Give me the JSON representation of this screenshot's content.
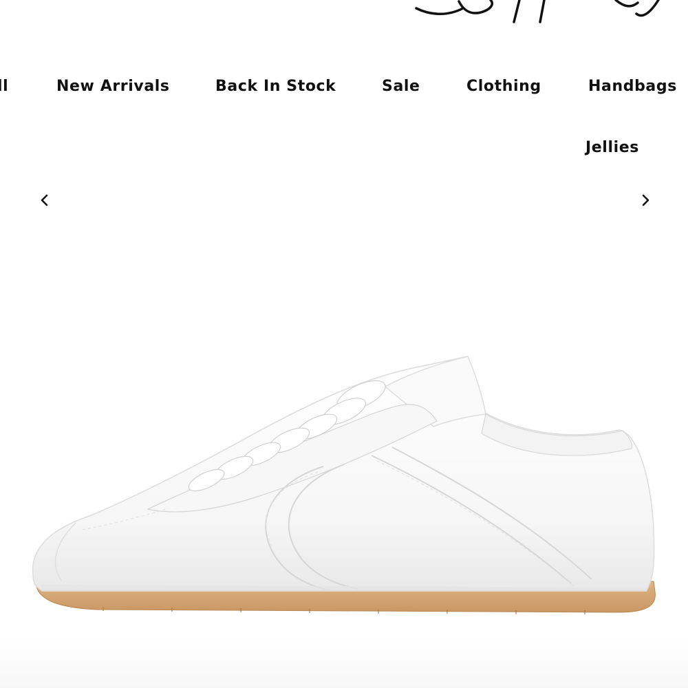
{
  "brand": {
    "logo_name": "brand-logo-signature"
  },
  "nav": {
    "items": [
      {
        "label": "ll"
      },
      {
        "label": "New Arrivals"
      },
      {
        "label": "Back In Stock"
      },
      {
        "label": "Sale"
      },
      {
        "label": "Clothing"
      },
      {
        "label": "Handbags"
      }
    ],
    "sub_item": {
      "label": "Jellies"
    }
  },
  "carousel": {
    "prev_icon": "chevron-left-icon",
    "next_icon": "chevron-right-icon"
  },
  "product": {
    "image": "white-leather-sneaker",
    "colors": {
      "upper": "#ffffff",
      "shadow": "#e2e2e2",
      "sole": "#d6a874"
    }
  },
  "colors": {
    "background": "#ffffff",
    "text": "#111111"
  }
}
